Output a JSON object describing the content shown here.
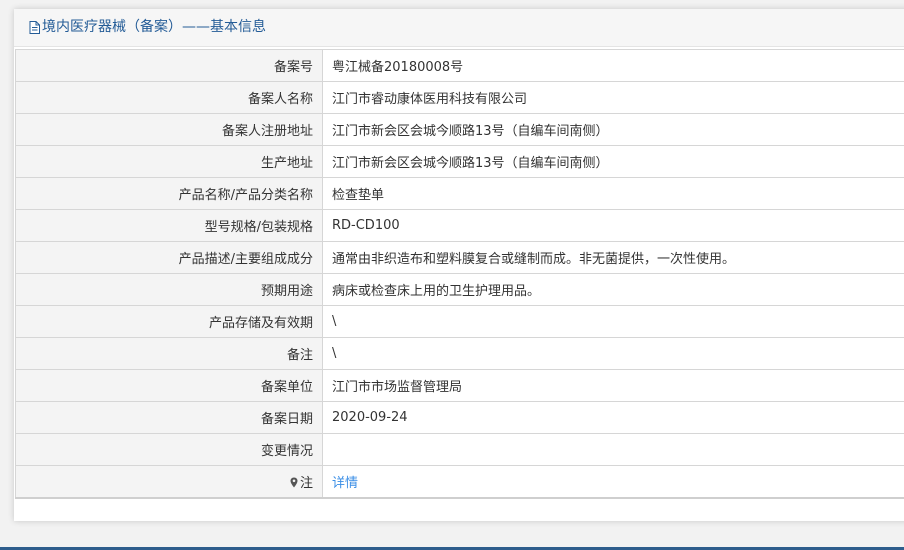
{
  "header": {
    "title": "境内医疗器械（备案）——基本信息",
    "icon": "document-icon"
  },
  "rows": [
    {
      "label": "备案号",
      "value": "粤江械备20180008号"
    },
    {
      "label": "备案人名称",
      "value": "江门市睿动康体医用科技有限公司"
    },
    {
      "label": "备案人注册地址",
      "value": "江门市新会区会城今顺路13号（自编车间南侧）"
    },
    {
      "label": "生产地址",
      "value": "江门市新会区会城今顺路13号（自编车间南侧）"
    },
    {
      "label": "产品名称/产品分类名称",
      "value": "检查垫单"
    },
    {
      "label": "型号规格/包装规格",
      "value": "RD-CD100"
    },
    {
      "label": "产品描述/主要组成成分",
      "value": "通常由非织造布和塑料膜复合或缝制而成。非无菌提供，一次性使用。"
    },
    {
      "label": "预期用途",
      "value": "病床或检查床上用的卫生护理用品。"
    },
    {
      "label": "产品存储及有效期",
      "value": "\\"
    },
    {
      "label": "备注",
      "value": "\\"
    },
    {
      "label": "备案单位",
      "value": "江门市市场监督管理局"
    },
    {
      "label": "备案日期",
      "value": "2020-09-24"
    },
    {
      "label": "变更情况",
      "value": ""
    },
    {
      "label": "注",
      "value": "详情",
      "icon": "map-pin-icon"
    }
  ],
  "colors": {
    "title": "#245c97",
    "link": "#3a8ee6",
    "label_bg": "#f4f4f4",
    "border": "#d6d6d6",
    "bottom_bar": "#2e5d8c"
  }
}
